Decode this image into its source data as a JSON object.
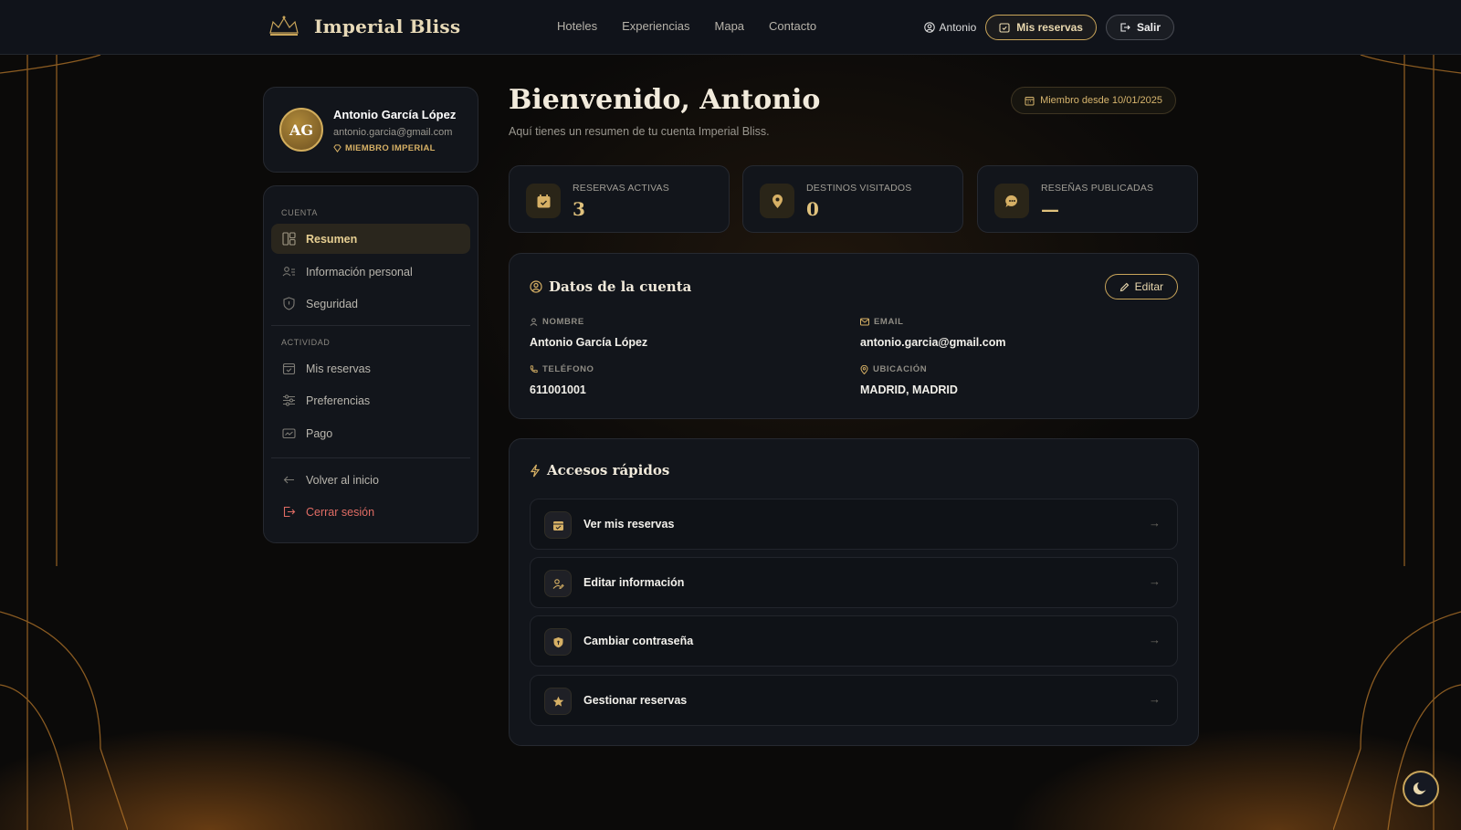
{
  "brand": {
    "name": "Imperial Bliss"
  },
  "nav": {
    "items": [
      "Hoteles",
      "Experiencias",
      "Mapa",
      "Contacto"
    ]
  },
  "top_actions": {
    "user": "Antonio",
    "reservations": "Mis reservas",
    "logout": "Salir"
  },
  "profile": {
    "initials": "AG",
    "name": "Antonio García López",
    "email": "antonio.garcia@gmail.com",
    "badge": "MIEMBRO IMPERIAL"
  },
  "sidebar": {
    "section_account": "CUENTA",
    "section_activity": "ACTIVIDAD",
    "items": [
      {
        "label": "Resumen",
        "icon": "dashboard-icon"
      },
      {
        "label": "Información personal",
        "icon": "user-card-icon"
      },
      {
        "label": "Seguridad",
        "icon": "shield-icon"
      },
      {
        "label": "Mis reservas",
        "icon": "calendar-check-icon"
      },
      {
        "label": "Preferencias",
        "icon": "sliders-icon"
      },
      {
        "label": "Pago",
        "icon": "credit-card-icon"
      },
      {
        "label": "Volver al inicio",
        "icon": "arrow-left-icon"
      },
      {
        "label": "Cerrar sesión",
        "icon": "logout-icon"
      }
    ]
  },
  "header": {
    "title": "Bienvenido, Antonio",
    "subtitle": "Aquí tienes un resumen de tu cuenta Imperial Bliss.",
    "member_since": "Miembro desde 10/01/2025"
  },
  "stats": [
    {
      "label": "RESERVAS ACTIVAS",
      "value": "3",
      "icon": "calendar-icon"
    },
    {
      "label": "DESTINOS VISITADOS",
      "value": "0",
      "icon": "map-pin-icon"
    },
    {
      "label": "RESEÑAS PUBLICADAS",
      "value": "—",
      "icon": "chat-icon"
    }
  ],
  "account": {
    "title": "Datos de la cuenta",
    "edit": "Editar",
    "fields": {
      "name_label": "NOMBRE",
      "name_value": "Antonio García López",
      "email_label": "EMAIL",
      "email_value": "antonio.garcia@gmail.com",
      "phone_label": "TELÉFONO",
      "phone_value": "611001001",
      "location_label": "UBICACIÓN",
      "location_value": "MADRID, MADRID"
    }
  },
  "quick": {
    "title": "Accesos rápidos",
    "items": [
      {
        "label": "Ver mis reservas",
        "icon": "calendar-icon"
      },
      {
        "label": "Editar información",
        "icon": "user-edit-icon"
      },
      {
        "label": "Cambiar contraseña",
        "icon": "shield-icon"
      },
      {
        "label": "Gestionar reservas",
        "icon": "star-icon"
      }
    ],
    "arrow": "→"
  },
  "colors": {
    "accent": "#c9a55a",
    "background": "#0b0a09",
    "panel": "#12151b",
    "danger": "#e06c64"
  }
}
